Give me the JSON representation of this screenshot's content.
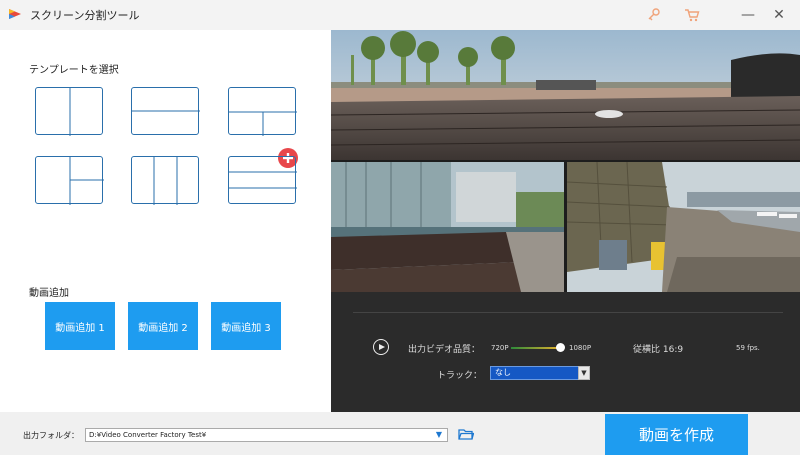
{
  "app": {
    "title": "スクリーン分割ツール"
  },
  "window": {
    "minimize": "—",
    "close": "✕"
  },
  "templates": {
    "heading": "テンプレートを選択",
    "items": [
      {
        "name": "two-vertical"
      },
      {
        "name": "two-horizontal"
      },
      {
        "name": "one-top-two-bottom"
      },
      {
        "name": "one-left-two-right"
      },
      {
        "name": "three-vertical"
      },
      {
        "name": "three-horizontal"
      }
    ]
  },
  "video_add": {
    "heading": "動画追加",
    "buttons": [
      "動画追加 1",
      "動画追加 2",
      "動画追加 3"
    ]
  },
  "controls": {
    "quality_label": "出力ビデオ品質：",
    "quality_min": "720P",
    "quality_max": "1080P",
    "quality_value_fraction": 1.0,
    "aspect_label": "従横比 16:9",
    "fps": "59 fps.",
    "track_label": "トラック：",
    "track_value": "なし"
  },
  "output": {
    "label": "出力フォルダ：",
    "path": "D:¥Video Converter Factory Test¥"
  },
  "create_button": "動画を作成",
  "colors": {
    "accent": "#1e9cf0",
    "template_border": "#2a6fab",
    "plus_badge": "#e8474b",
    "icon_orange": "#f0a37a"
  },
  "icons": [
    "key-icon",
    "cart-icon",
    "plus-icon",
    "play-icon",
    "folder-icon",
    "chevron-down-icon"
  ]
}
